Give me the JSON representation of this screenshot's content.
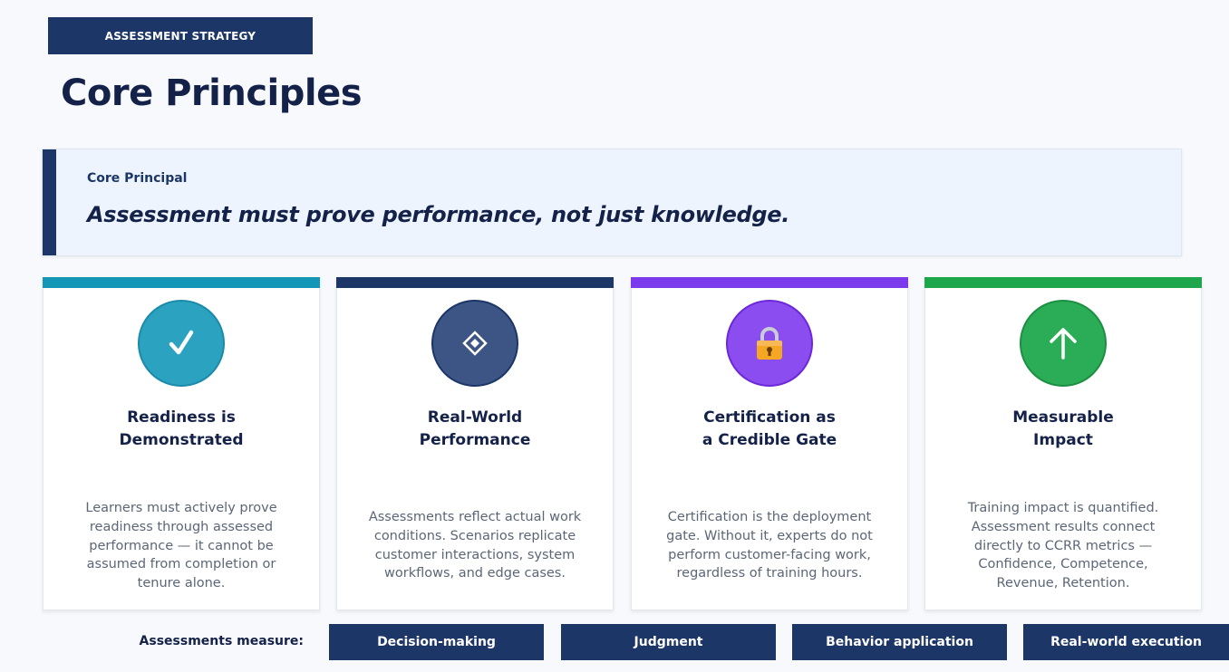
{
  "header": {
    "tag": "ASSESSMENT STRATEGY",
    "title": "Core Principles"
  },
  "principle": {
    "label": "Core Principal",
    "statement": "Assessment must prove performance, not just knowledge."
  },
  "cards": [
    {
      "icon": "checkmark-icon",
      "accent": "#1497b7",
      "circle_color": "#2ba3c0",
      "heading_line1": "Readiness is",
      "heading_line2": "Demonstrated",
      "description": "Learners must actively prove readiness through assessed performance — it cannot be assumed from completion or tenure alone."
    },
    {
      "icon": "diamond-icon",
      "accent": "#1c3668",
      "circle_color": "#3c5585",
      "heading_line1": "Real-World",
      "heading_line2": "Performance",
      "description": "Assessments reflect actual work conditions. Scenarios replicate customer interactions, system workflows, and edge cases."
    },
    {
      "icon": "lock-icon",
      "accent": "#7c3aed",
      "circle_color": "#8b4cf0",
      "heading_line1": "Certification as",
      "heading_line2": "a Credible Gate",
      "description": "Certification is the deployment gate. Without it, experts do not perform customer-facing work, regardless of training hours."
    },
    {
      "icon": "arrow-up-icon",
      "accent": "#1ea64c",
      "circle_color": "#2bad57",
      "heading_line1": "Measurable",
      "heading_line2": "Impact",
      "description": "Training impact is quantified. Assessment results connect directly to CCRR metrics — Confidence, Competence, Revenue, Retention."
    }
  ],
  "measures": {
    "label": "Assessments measure:",
    "items": [
      "Decision-making",
      "Judgment",
      "Behavior application",
      "Real-world execution"
    ]
  }
}
